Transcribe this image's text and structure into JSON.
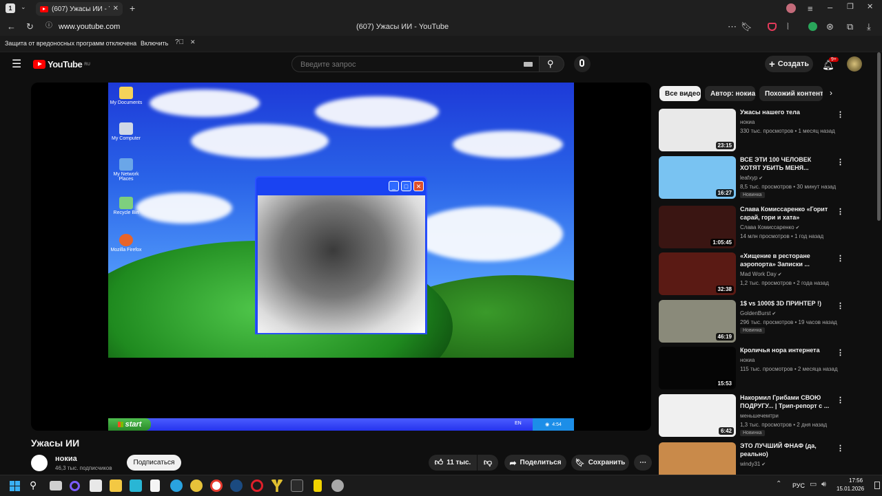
{
  "browser": {
    "tab_title": "(607) Ужасы ИИ - YouTu",
    "url": "www.youtube.com",
    "window_title": "(607) Ужасы ИИ - YouTube",
    "profile_badge": "1"
  },
  "infobar": {
    "message": "Защита от вредоносных программ отключена",
    "action": "Включить"
  },
  "header": {
    "logo": "YouTube",
    "region": "RU",
    "search_placeholder": "Введите запрос",
    "create_label": "Создать",
    "notif_count": "9+"
  },
  "video": {
    "title": "Ужасы ИИ",
    "channel": "нокиа",
    "subscribers": "46,3 тыс. подписчиков",
    "subscribe_label": "Подписаться",
    "likes": "11 тыс.",
    "share_label": "Поделиться",
    "save_label": "Сохранить",
    "xp": {
      "icons": [
        "My Documents",
        "My Computer",
        "My Network Places",
        "Recycle Bin",
        "Mozilla Firefox"
      ],
      "start": "start",
      "lang": "EN",
      "clock": "4:54"
    }
  },
  "chips": [
    "Все видео",
    "Автор: нокиа",
    "Похожий контент"
  ],
  "recommendations": [
    {
      "title": "Ужасы нашего тела",
      "channel": "нокиа",
      "meta": "330 тыс. просмотров • 1 месяц назад",
      "duration": "23:15",
      "badge": "",
      "verified": false,
      "thumb_color": "#e9e9e9"
    },
    {
      "title": "ВСЕ ЭТИ 100 ЧЕЛОВЕК ХОТЯТ УБИТЬ МЕНЯ...",
      "channel": "leafxyp",
      "meta": "8,5 тыс. просмотров • 30 минут назад",
      "duration": "16:27",
      "badge": "Новинка",
      "verified": true,
      "thumb_color": "#79c3f2"
    },
    {
      "title": "Слава Комиссаренко «Горит сарай, гори и хата»",
      "channel": "Слава Комиссаренко",
      "meta": "14 млн просмотров • 1 год назад",
      "duration": "1:05:45",
      "badge": "",
      "verified": true,
      "thumb_color": "#3a1512"
    },
    {
      "title": "«Хищение в ресторане аэропорта» Записки ...",
      "channel": "Mad Work Day",
      "meta": "1,2 тыс. просмотров • 2 года назад",
      "duration": "32:38",
      "badge": "",
      "verified": true,
      "thumb_color": "#5a1a14"
    },
    {
      "title": "1$ vs 1000$ 3D ПРИНТЕР !)",
      "channel": "GoldenBurst",
      "meta": "296 тыс. просмотров • 19 часов назад",
      "duration": "46:19",
      "badge": "Новинка",
      "verified": true,
      "thumb_color": "#8a8a7a"
    },
    {
      "title": "Кроличья нора интернета",
      "channel": "нокиа",
      "meta": "115 тыс. просмотров • 2 месяца назад",
      "duration": "15:53",
      "badge": "",
      "verified": false,
      "thumb_color": "#050505"
    },
    {
      "title": "Накормил Грибами СВОЮ ПОДРУГУ... | Трип-репорт с ...",
      "channel": "меньшечемтри",
      "meta": "1,3 тыс. просмотров • 2 дня назад",
      "duration": "6:42",
      "badge": "Новинка",
      "verified": false,
      "thumb_color": "#f0f0f0"
    },
    {
      "title": "ЭТО ЛУЧШИЙ ФНАФ (да, реально)",
      "channel": "windy31",
      "meta": "",
      "duration": "",
      "badge": "",
      "verified": true,
      "thumb_color": "#c98a4a"
    }
  ],
  "taskbar": {
    "lang": "РУС",
    "time": "17:56",
    "date": "15.01.2026"
  }
}
